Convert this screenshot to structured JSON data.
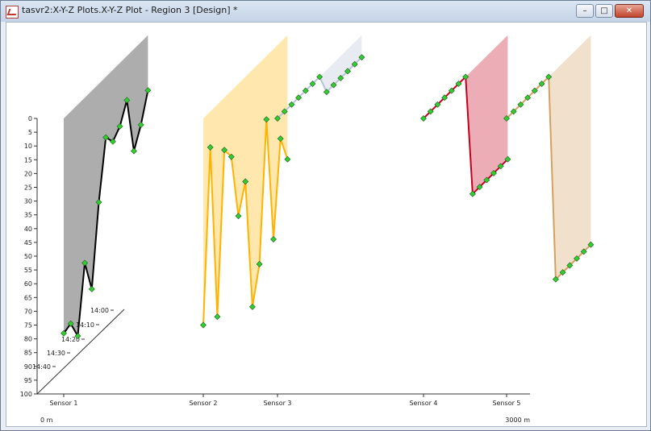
{
  "window": {
    "title": "tasvr2:X-Y-Z Plots.X-Y-Z Plot - Region 3 [Design] *",
    "buttons": {
      "minimize": "–",
      "maximize": "□",
      "close": "✕"
    }
  },
  "colors": {
    "sensor1": "#000000",
    "sensor2": "#ffb300",
    "sensor3": "#b8c4d6",
    "sensor4": "#c4001e",
    "sensor5": "#d4a060",
    "marker": "#33cc33"
  },
  "chart_data": {
    "type": "line",
    "projection": "3d-xyz",
    "y_axis": {
      "ticks": [
        0,
        5,
        10,
        15,
        20,
        25,
        30,
        35,
        40,
        45,
        50,
        55,
        60,
        65,
        70,
        75,
        80,
        85,
        90,
        95,
        100
      ],
      "range": [
        0,
        100
      ],
      "inverted": true
    },
    "x_axis": {
      "categories": [
        "Sensor 1",
        "Sensor 2",
        "Sensor 3",
        "Sensor 4",
        "Sensor 5"
      ],
      "range_labels": [
        "0 m",
        "3000 m"
      ]
    },
    "z_axis": {
      "labels": [
        "14:40",
        "14:30",
        "14:20",
        "14:10",
        "14:00"
      ]
    },
    "series": [
      {
        "category": "Sensor 1",
        "points": [
          {
            "t": 0,
            "v": 78
          },
          {
            "t": 1,
            "v": 77
          },
          {
            "t": 2,
            "v": 84
          },
          {
            "t": 3,
            "v": 60
          },
          {
            "t": 4,
            "v": 72
          },
          {
            "t": 5,
            "v": 43
          },
          {
            "t": 6,
            "v": 22
          },
          {
            "t": 7,
            "v": 26
          },
          {
            "t": 8,
            "v": 23
          },
          {
            "t": 9,
            "v": 16
          },
          {
            "t": 10,
            "v": 37
          },
          {
            "t": 11,
            "v": 30
          },
          {
            "t": 12,
            "v": 20
          }
        ]
      },
      {
        "category": "Sensor 2",
        "points": [
          {
            "t": 0,
            "v": 75
          },
          {
            "t": 1,
            "v": 13
          },
          {
            "t": 2,
            "v": 77
          },
          {
            "t": 3,
            "v": 19
          },
          {
            "t": 4,
            "v": 24
          },
          {
            "t": 5,
            "v": 48
          },
          {
            "t": 6,
            "v": 38
          },
          {
            "t": 7,
            "v": 86
          },
          {
            "t": 8,
            "v": 73
          },
          {
            "t": 9,
            "v": 23
          },
          {
            "t": 10,
            "v": 69
          },
          {
            "t": 11,
            "v": 35
          },
          {
            "t": 12,
            "v": 45
          }
        ]
      },
      {
        "category": "Sensor 3",
        "points": [
          {
            "t": 0,
            "v": 0
          },
          {
            "t": 1,
            "v": 0
          },
          {
            "t": 2,
            "v": 0
          },
          {
            "t": 3,
            "v": 0
          },
          {
            "t": 4,
            "v": 0
          },
          {
            "t": 5,
            "v": 0
          },
          {
            "t": 6,
            "v": 0
          },
          {
            "t": 7,
            "v": 8
          },
          {
            "t": 8,
            "v": 8
          },
          {
            "t": 9,
            "v": 8
          },
          {
            "t": 10,
            "v": 8
          },
          {
            "t": 11,
            "v": 8
          },
          {
            "t": 12,
            "v": 8
          }
        ]
      },
      {
        "category": "Sensor 4",
        "points": [
          {
            "t": 0,
            "v": 0
          },
          {
            "t": 1,
            "v": 0
          },
          {
            "t": 2,
            "v": 0
          },
          {
            "t": 3,
            "v": 0
          },
          {
            "t": 4,
            "v": 0
          },
          {
            "t": 5,
            "v": 0
          },
          {
            "t": 6,
            "v": 0
          },
          {
            "t": 7,
            "v": 45
          },
          {
            "t": 8,
            "v": 45
          },
          {
            "t": 9,
            "v": 45
          },
          {
            "t": 10,
            "v": 45
          },
          {
            "t": 11,
            "v": 45
          },
          {
            "t": 12,
            "v": 45
          }
        ]
      },
      {
        "category": "Sensor 5",
        "points": [
          {
            "t": 0,
            "v": 0
          },
          {
            "t": 1,
            "v": 0
          },
          {
            "t": 2,
            "v": 0
          },
          {
            "t": 3,
            "v": 0
          },
          {
            "t": 4,
            "v": 0
          },
          {
            "t": 5,
            "v": 0
          },
          {
            "t": 6,
            "v": 0
          },
          {
            "t": 7,
            "v": 76
          },
          {
            "t": 8,
            "v": 76
          },
          {
            "t": 9,
            "v": 76
          },
          {
            "t": 10,
            "v": 76
          },
          {
            "t": 11,
            "v": 76
          },
          {
            "t": 12,
            "v": 76
          }
        ]
      }
    ]
  }
}
